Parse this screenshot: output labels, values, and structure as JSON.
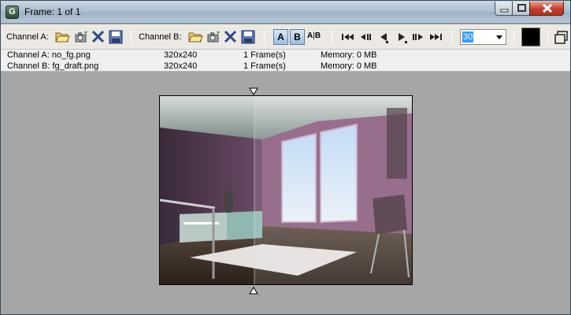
{
  "window": {
    "title": "Frame: 1 of 1",
    "app_icon_letter": "G"
  },
  "toolbar": {
    "channel_a_label": "Channel A:",
    "channel_b_label": "Channel B:",
    "a_button": "A",
    "b_button": "B",
    "split_left": "A",
    "split_right": "B",
    "frame_rate": "30",
    "background_color": "#000000"
  },
  "channels": [
    {
      "name": "Channel A: no_fg.png",
      "resolution": "320x240",
      "frames": "1 Frame(s)",
      "memory": "Memory: 0 MB"
    },
    {
      "name": "Channel B: fg_draft.png",
      "resolution": "320x240",
      "frames": "1 Frame(s)",
      "memory": "Memory: 0 MB"
    }
  ],
  "colors": {
    "titlebar": "#aebfd0",
    "toolbar": "#ece9e4",
    "display_bg": "#a6a6a6",
    "close_button": "#c2402a",
    "selection": "#3399ff"
  },
  "icons": [
    "open-folder-icon",
    "camera-icon",
    "clear-icon",
    "save-icon",
    "go-to-start-icon",
    "prev-frame-icon",
    "play-reverse-icon",
    "play-icon",
    "next-frame-icon",
    "go-to-end-icon"
  ]
}
